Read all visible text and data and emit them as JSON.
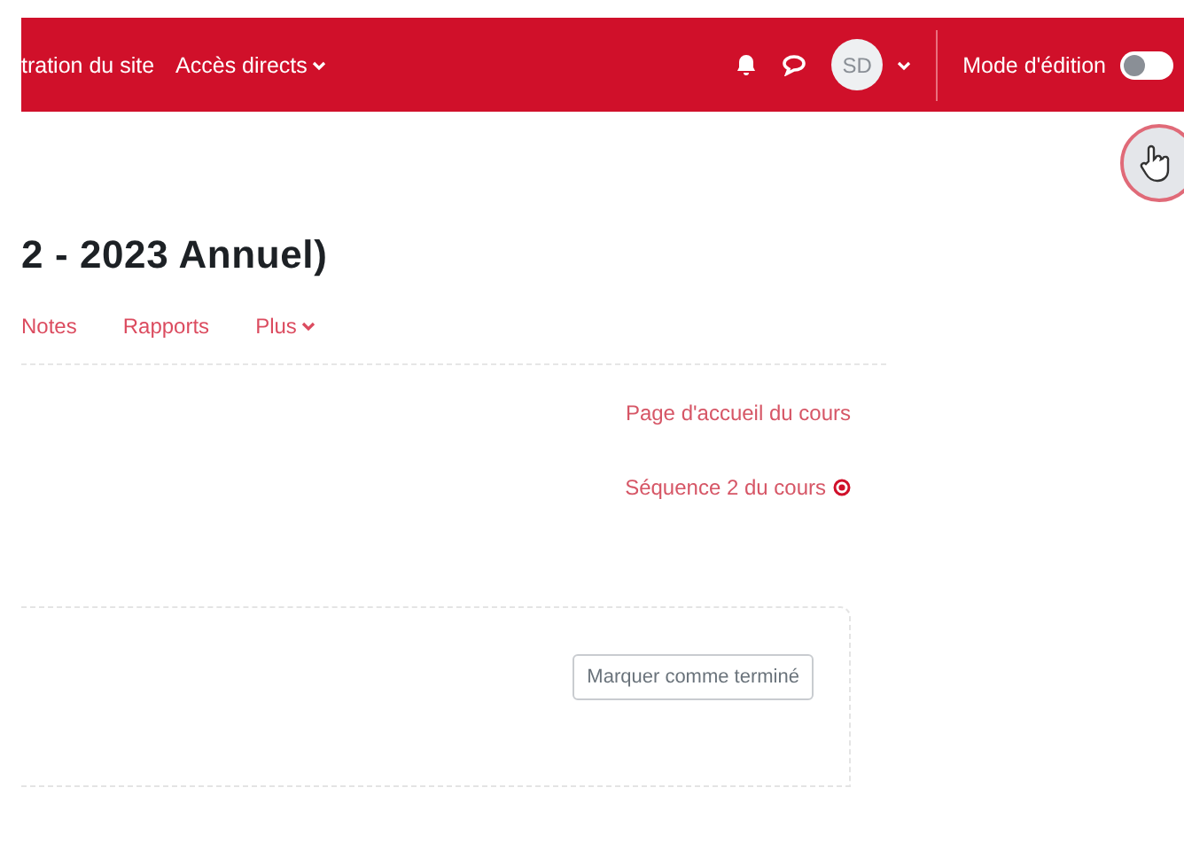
{
  "navbar": {
    "links": [
      {
        "label": "tration du site",
        "dropdown": false
      },
      {
        "label": "Accès directs",
        "dropdown": true
      }
    ],
    "avatar": "SD",
    "edit_mode": {
      "label": "Mode d'édition",
      "on": false
    }
  },
  "course": {
    "title": "2 - 2023 Annuel)",
    "tabs": [
      {
        "label": "Notes",
        "dropdown": false
      },
      {
        "label": "Rapports",
        "dropdown": false
      },
      {
        "label": "Plus",
        "dropdown": true
      }
    ],
    "links": [
      {
        "label": "Page d'accueil du cours",
        "icon": false
      },
      {
        "label": "Séquence 2 du cours",
        "icon": true
      }
    ],
    "activity": {
      "button": "Marquer comme terminé"
    }
  }
}
